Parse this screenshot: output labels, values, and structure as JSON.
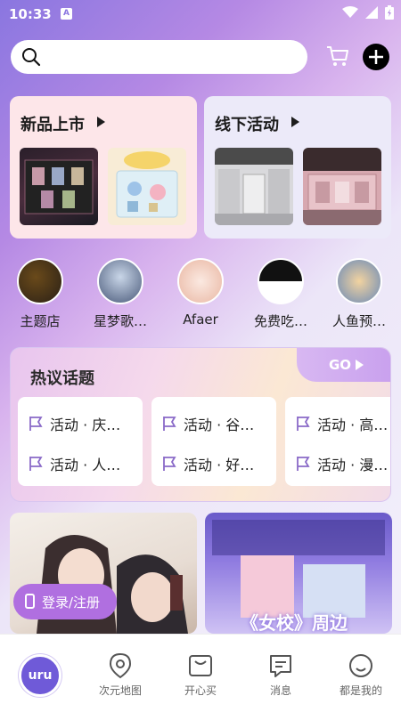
{
  "status_bar": {
    "time": "10:33",
    "notif": "A"
  },
  "search": {
    "placeholder": ""
  },
  "promo": {
    "left": {
      "title": "新品上市"
    },
    "right": {
      "title": "线下活动"
    }
  },
  "circles": [
    {
      "label": "主题店"
    },
    {
      "label": "星梦歌…"
    },
    {
      "label": "Afaer"
    },
    {
      "label": "免费吃…"
    },
    {
      "label": "人鱼预…"
    }
  ],
  "hot_topics": {
    "title": "热议话题",
    "go_label": "GO",
    "cards": [
      {
        "line1": "活动 · 庆…",
        "line2": "活动 · 人…"
      },
      {
        "line1": "活动 · 谷…",
        "line2": "活动 · 好…"
      },
      {
        "line1": "活动 · 高…",
        "line2": "活动 · 漫…"
      }
    ]
  },
  "feed": {
    "left_caption": "",
    "right_caption": "《女校》周边",
    "login_label": "登录/注册"
  },
  "tabs": [
    {
      "label": "",
      "logo": "uru"
    },
    {
      "label": "次元地图"
    },
    {
      "label": "开心买"
    },
    {
      "label": "消息"
    },
    {
      "label": "都是我的"
    }
  ],
  "colors": {
    "accent": "#8a76e0",
    "login": "#b06fe0"
  }
}
